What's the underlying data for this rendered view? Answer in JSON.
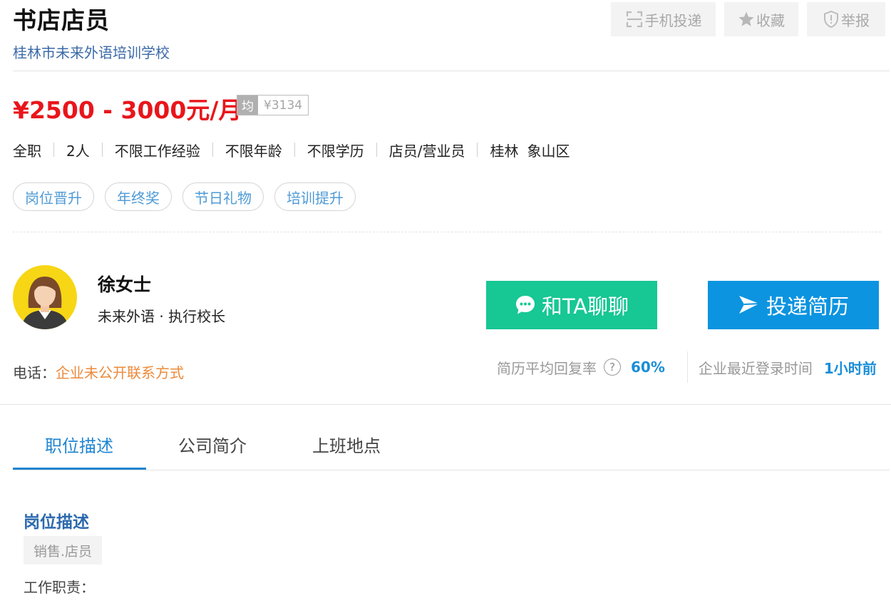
{
  "header": {
    "job_title": "书店店员",
    "company": "桂林市未来外语培训学校",
    "buttons": {
      "mobile": "手机投递",
      "favorite": "收藏",
      "report": "举报"
    }
  },
  "salary": {
    "range": "¥2500 - 3000元/月",
    "avg_label": "均",
    "avg_value": "¥3134"
  },
  "requirements": [
    "全职",
    "2人",
    "不限工作经验",
    "不限年龄",
    "不限学历",
    "店员/营业员"
  ],
  "location": {
    "city": "桂林",
    "district": "象山区"
  },
  "tags": [
    "岗位晋升",
    "年终奖",
    "节日礼物",
    "培训提升"
  ],
  "contact": {
    "name": "徐女士",
    "role": "未来外语 · 执行校长",
    "chat_button": "和TA聊聊",
    "apply_button": "投递简历",
    "phone_label": "电话：",
    "phone_value": "企业未公开联系方式"
  },
  "stats": {
    "reply_rate_label": "简历平均回复率",
    "help": "?",
    "reply_rate_value": "60%",
    "login_label": "企业最近登录时间",
    "login_value": "1小时前"
  },
  "tabs": [
    "职位描述",
    "公司简介",
    "上班地点"
  ],
  "description": {
    "section_title": "岗位描述",
    "category": "销售.店员",
    "duties_label": "工作职责："
  },
  "colors": {
    "salary": "#e8161c",
    "chat_button": "#17c794",
    "apply_button": "#0c94e0",
    "accent_blue": "#2085d1",
    "phone_orange": "#ec8a3a"
  }
}
